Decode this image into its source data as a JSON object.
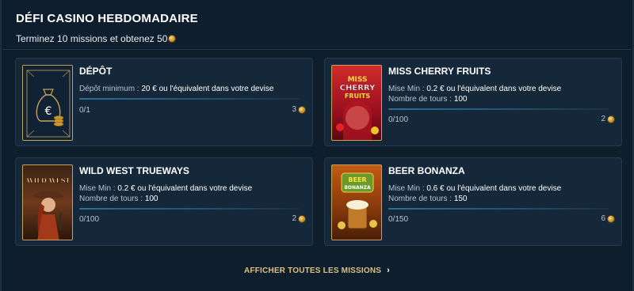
{
  "header": {
    "title": "DÉFI CASINO HEBDOMADAIRE",
    "subtitle": "Terminez 10 missions et obtenez 50"
  },
  "missions": [
    {
      "title": "DÉPÔT",
      "line1_label": "Dépôt minimum : ",
      "line1_value": "20 €",
      "line1_suffix": " ou l'équivalent dans votre devise",
      "progress": "0/1",
      "reward": "3",
      "icon": "money-bag-icon"
    },
    {
      "title": "MISS CHERRY FRUITS",
      "line1_label": "Mise Min : ",
      "line1_value": "0.2 €",
      "line1_suffix": " ou l'équivalent dans votre devise",
      "line2_label": "Nombre de tours : ",
      "line2_value": "100",
      "progress": "0/100",
      "reward": "2",
      "thumb_text_1": "MISS",
      "thumb_text_2": "CHERRY",
      "thumb_text_3": "FRUITS"
    },
    {
      "title": "WILD WEST TRUEWAYS",
      "line1_label": "Mise Min : ",
      "line1_value": "0.2 €",
      "line1_suffix": " ou l'équivalent dans votre devise",
      "line2_label": "Nombre de tours : ",
      "line2_value": "100",
      "progress": "0/100",
      "reward": "2",
      "thumb_text_1": "WILD WEST"
    },
    {
      "title": "BEER BONANZA",
      "line1_label": "Mise Min : ",
      "line1_value": "0.6 €",
      "line1_suffix": " ou l'équivalent dans votre devise",
      "line2_label": "Nombre de tours : ",
      "line2_value": "150",
      "progress": "0/150",
      "reward": "6",
      "thumb_text_1": "BEER",
      "thumb_text_2": "BONANZA"
    }
  ],
  "footer": {
    "link_label": "AFFICHER TOUTES LES MISSIONS"
  },
  "colors": {
    "background": "#0f1e2d",
    "card": "#14283a",
    "accent_gold": "#c5a25a",
    "link_gold": "#dbc082"
  }
}
